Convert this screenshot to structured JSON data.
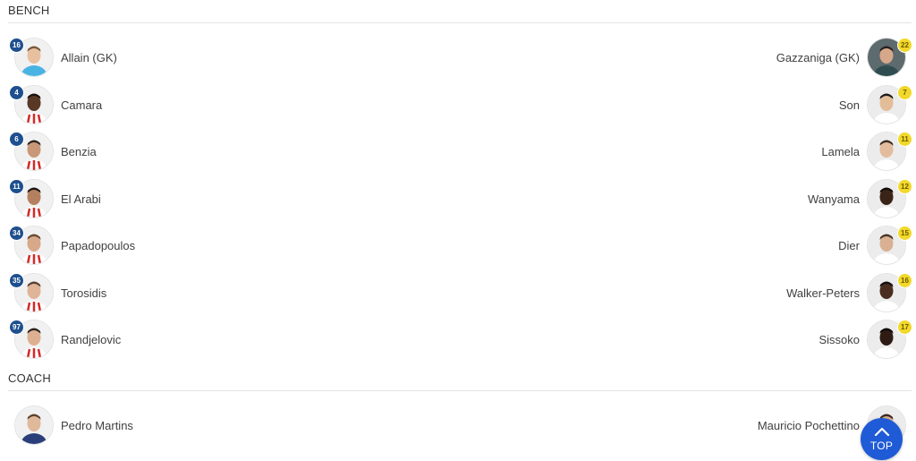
{
  "sections": {
    "bench_title": "BENCH",
    "coach_title": "COACH"
  },
  "colors": {
    "home_badge": "#1e4f8e",
    "away_badge": "#f2d82a",
    "top_button": "#1f5bd6"
  },
  "bench": [
    {
      "home": {
        "name": "Allain (GK)",
        "number": "16"
      },
      "away": {
        "name": "Gazzaniga (GK)",
        "number": "22"
      }
    },
    {
      "home": {
        "name": "Camara",
        "number": "4"
      },
      "away": {
        "name": "Son",
        "number": "7"
      }
    },
    {
      "home": {
        "name": "Benzia",
        "number": "6"
      },
      "away": {
        "name": "Lamela",
        "number": "11"
      }
    },
    {
      "home": {
        "name": "El Arabi",
        "number": "11"
      },
      "away": {
        "name": "Wanyama",
        "number": "12"
      }
    },
    {
      "home": {
        "name": "Papadopoulos",
        "number": "34"
      },
      "away": {
        "name": "Dier",
        "number": "15"
      }
    },
    {
      "home": {
        "name": "Torosidis",
        "number": "35"
      },
      "away": {
        "name": "Walker-Peters",
        "number": "16"
      }
    },
    {
      "home": {
        "name": "Randjelovic",
        "number": "97"
      },
      "away": {
        "name": "Sissoko",
        "number": "17"
      }
    }
  ],
  "coach": {
    "home": {
      "name": "Pedro Martins"
    },
    "away": {
      "name": "Mauricio Pochettino"
    }
  },
  "top_button": {
    "label": "TOP",
    "icon": "chevron-up-icon"
  }
}
